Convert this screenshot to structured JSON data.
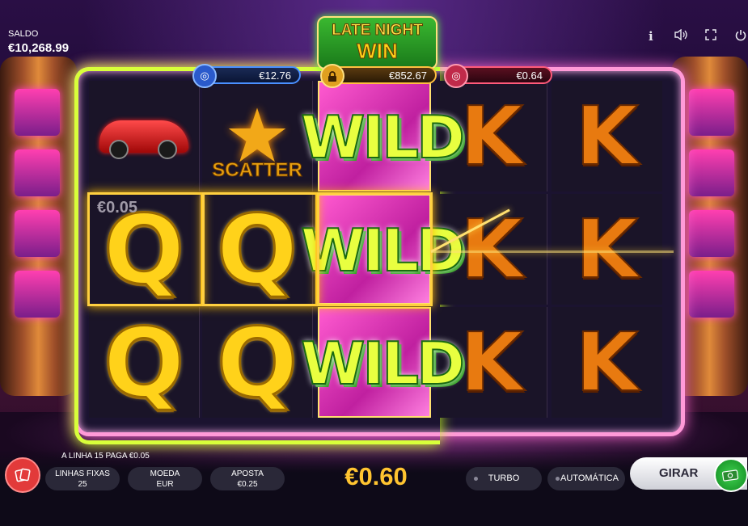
{
  "header": {
    "balance_label": "SALDO",
    "balance_value": "€10,268.99",
    "icons": [
      "info-icon",
      "sound-icon",
      "fullscreen-icon",
      "power-icon"
    ],
    "info_glyph": "i"
  },
  "logo": {
    "line1": "LATE NIGHT",
    "line2": "WIN"
  },
  "jackpots": [
    {
      "name": "blue",
      "value": "€12.76",
      "color": "#4a90ff"
    },
    {
      "name": "gold",
      "value": "€852.67",
      "color": "#ffc040"
    },
    {
      "name": "red",
      "value": "€0.64",
      "color": "#ff5a7a"
    }
  ],
  "reels": {
    "rows": [
      [
        "car",
        "scatter",
        "wild",
        "K",
        "K"
      ],
      [
        "Q",
        "Q",
        "wild",
        "K",
        "K"
      ],
      [
        "Q",
        "Q",
        "wild",
        "K",
        "K"
      ]
    ],
    "wild_text": "WILD",
    "scatter_text": "SCATTER",
    "q_text": "Q",
    "k_text": "K",
    "line_win_amount": "€0.05"
  },
  "footer": {
    "message": "A LINHA 15 PAGA €0.05",
    "lines_label": "LINHAS FIXAS",
    "lines_value": "25",
    "coin_label": "MOEDA",
    "coin_value": "EUR",
    "bet_label": "APOSTA",
    "bet_value": "€0.25",
    "total_bet": "€0.60",
    "turbo_label": "TURBO",
    "auto_label": "AUTOMÁTICA",
    "spin_label": "GIRAR"
  },
  "colors": {
    "accent_gold": "#ffc430",
    "frame_green": "#d8ff3a",
    "frame_pink": "#ff9ad8"
  }
}
